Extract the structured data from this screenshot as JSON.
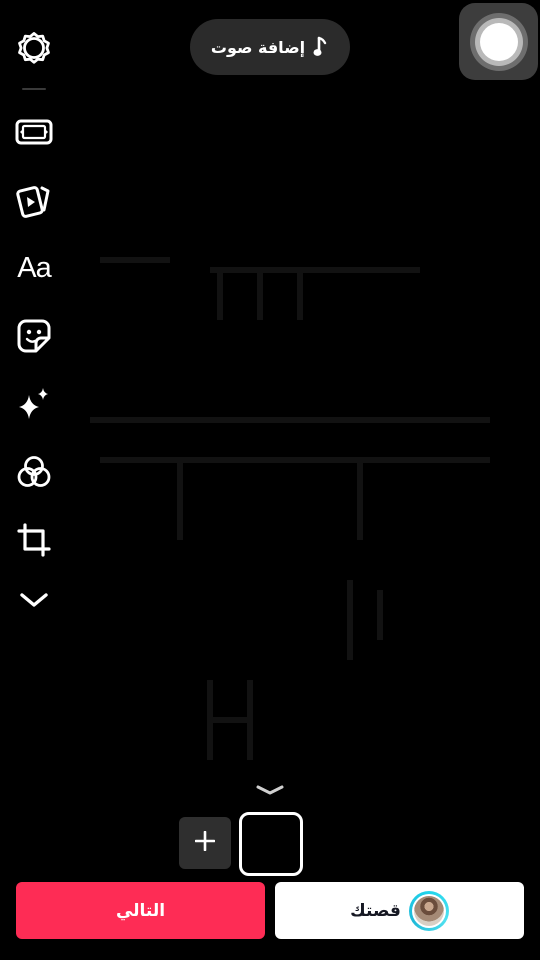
{
  "top": {
    "add_sound_label": "إضافة صوت",
    "music_icon": "music-note-icon",
    "assistive_touch_icon": "assistive-touch-icon"
  },
  "toolbar": {
    "items": [
      {
        "name": "settings",
        "icon": "gear-icon"
      },
      {
        "name": "aspect-ratio",
        "icon": "aspect-ratio-icon"
      },
      {
        "name": "templates",
        "icon": "video-cards-icon"
      },
      {
        "name": "text",
        "icon": "text-aa-icon",
        "label": "Aa"
      },
      {
        "name": "stickers",
        "icon": "sticker-icon"
      },
      {
        "name": "effects",
        "icon": "sparkles-icon"
      },
      {
        "name": "filters",
        "icon": "filters-icon"
      },
      {
        "name": "crop",
        "icon": "crop-icon"
      },
      {
        "name": "more",
        "icon": "chevron-down-icon"
      }
    ]
  },
  "clips": {
    "collapse_icon": "chevron-down-icon",
    "add_label": "+"
  },
  "bottom": {
    "story_label": "قصتك",
    "next_label": "التالي",
    "next_color": "#fe2c55",
    "story_ring_color": "#20d5ec"
  }
}
